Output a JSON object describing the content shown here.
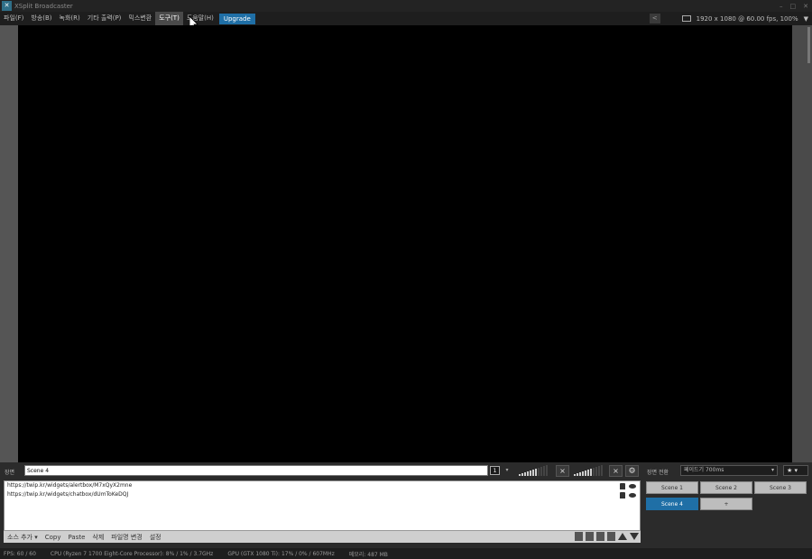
{
  "window": {
    "title": "XSplit Broadcaster",
    "controls": [
      "–",
      "□",
      "✕"
    ]
  },
  "menu": {
    "items": [
      "파일(F)",
      "방송(B)",
      "녹화(R)",
      "기타 출력(P)",
      "믹스변환",
      "도구(T)",
      "도움말(H)"
    ],
    "active_index": 5,
    "upgrade": "Upgrade",
    "resolution": "1920 x 1080 @ 60.00 fps, 100%",
    "dropdown": "▼"
  },
  "scene_bar": {
    "label": "장면",
    "scene_name": "Scene 4",
    "layout_number": "1",
    "transition_label": "장면 전환",
    "transition_value": "페이드기 700ms",
    "fav_icon": "★"
  },
  "sources": [
    {
      "url": "https://twip.kr/widgets/alertbox/M7xQyX2mne"
    },
    {
      "url": "https://twip.kr/widgets/chatbox/dUmToKeDQJ"
    }
  ],
  "source_toolbar": [
    "소스 추가 ▾",
    "Copy",
    "Paste",
    "삭제",
    "파일명 변경",
    "설정"
  ],
  "scenes": [
    {
      "label": "Scene 1",
      "active": false
    },
    {
      "label": "Scene 2",
      "active": false
    },
    {
      "label": "Scene 3",
      "active": false
    },
    {
      "label": "Scene 4",
      "active": true
    },
    {
      "label": "+",
      "active": false
    }
  ],
  "status": {
    "fps": "FPS:  60 / 60",
    "cpu": "CPU (Ryzen 7 1700 Eight-Core Processor):   8% / 1% / 3.7GHz",
    "gpu": "GPU (GTX 1080 Ti):   17% / 0% / 607MHz",
    "memory": "메모리:   487 MB"
  },
  "colors": {
    "accent": "#1f6fa6",
    "preview_bg": "#000000",
    "panel_bg": "#2b2b2b"
  }
}
